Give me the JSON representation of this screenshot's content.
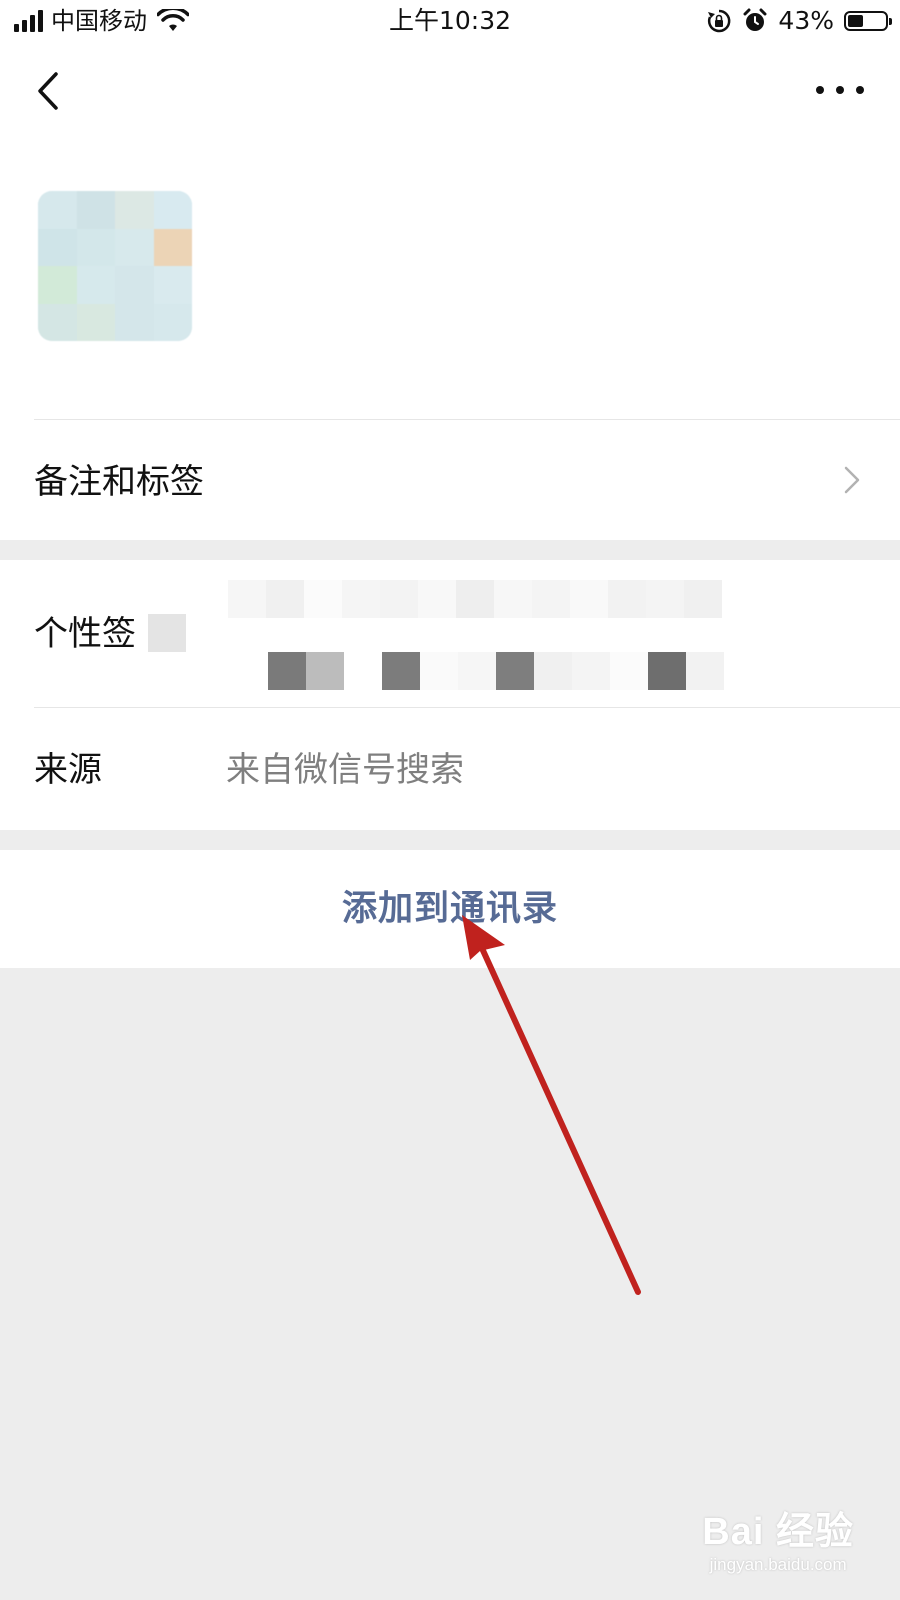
{
  "status_bar": {
    "carrier": "中国移动",
    "time": "上午10:32",
    "battery_percent": "43%",
    "battery_level": 0.43,
    "icons": [
      "signal-icon",
      "wifi-icon",
      "rotation-lock-icon",
      "alarm-icon",
      "battery-icon"
    ]
  },
  "nav": {
    "back_icon": "chevron-left-icon",
    "more_icon": "more-icon"
  },
  "profile": {
    "name": "",
    "wechat_id": ""
  },
  "cells": {
    "remark_label": "备注和标签",
    "signature_label": "个性签",
    "source_label": "来源",
    "source_value": "来自微信号搜索"
  },
  "action": {
    "add_to_contacts": "添加到通讯录"
  },
  "watermark": {
    "logo": "Bai 经验",
    "url": "jingyan.baidu.com"
  },
  "colors": {
    "link": "#576b95",
    "background": "#ededed",
    "annotation_arrow": "#c0221e"
  }
}
